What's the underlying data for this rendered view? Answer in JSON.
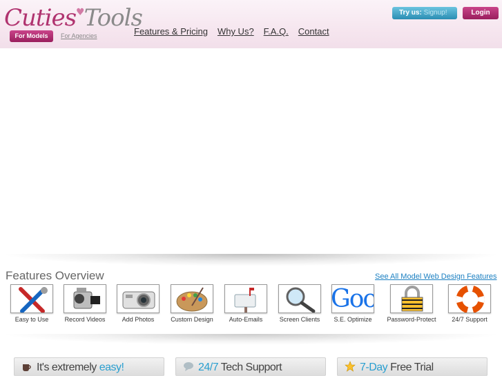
{
  "header": {
    "logo_part1": "Cuties",
    "logo_part2": "Tools",
    "logo_heart": "♥",
    "tab_models": "For Models",
    "tab_agencies": "For Agencies",
    "nav": [
      "Features & Pricing",
      "Why Us?",
      "F.A.Q.",
      "Contact"
    ],
    "try_label": "Try us:",
    "signup_label": "Signup!",
    "login_label": "Login"
  },
  "features": {
    "title": "Features Overview",
    "link": "See All Model Web Design Features",
    "items": [
      {
        "label": "Easy to Use",
        "icon": "tools-icon"
      },
      {
        "label": "Record Videos",
        "icon": "camcorder-icon"
      },
      {
        "label": "Add Photos",
        "icon": "camera-icon"
      },
      {
        "label": "Custom Design",
        "icon": "palette-icon"
      },
      {
        "label": "Auto-Emails",
        "icon": "mailbox-icon"
      },
      {
        "label": "Screen Clients",
        "icon": "magnifier-icon"
      },
      {
        "label": "S.E. Optimize",
        "icon": "google-icon"
      },
      {
        "label": "Password-Protect",
        "icon": "padlock-icon"
      },
      {
        "label": "24/7 Support",
        "icon": "lifebuoy-icon"
      }
    ],
    "google_text": "Goo"
  },
  "promos": [
    {
      "pre": "It's extremely ",
      "hl": "easy!",
      "icon": "coffee-icon"
    },
    {
      "pre": "",
      "hl": "24/7",
      "post": " Tech Support",
      "icon": "chat-bubble-icon"
    },
    {
      "pre": "",
      "hl": "7-Day",
      "post": " Free Trial",
      "icon": "star-icon"
    }
  ],
  "colors": {
    "brand_pink": "#b0336f",
    "accent_blue": "#2a9fd0",
    "link_blue": "#1a7fc1"
  }
}
